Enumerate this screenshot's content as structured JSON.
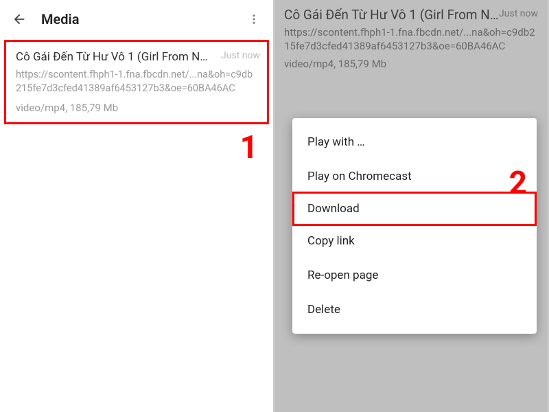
{
  "header": {
    "title": "Media"
  },
  "media": {
    "title": "Cô Gái Đến Từ Hư Vô 1 (Girl From N…",
    "timestamp": "Just now",
    "url": "https://scontent.fhph1-1.fna.fbcdn.net/...na&oh=c9db215fe7d3cfed41389af6453127b3&oe=60BA46AC",
    "meta": "video/mp4, 185,79 Mb"
  },
  "steps": {
    "one": "1",
    "two": "2"
  },
  "menu": {
    "play_with": "Play with …",
    "play_chromecast": "Play on Chromecast",
    "download": "Download",
    "copy_link": "Copy link",
    "reopen": "Re-open page",
    "delete": "Delete"
  }
}
